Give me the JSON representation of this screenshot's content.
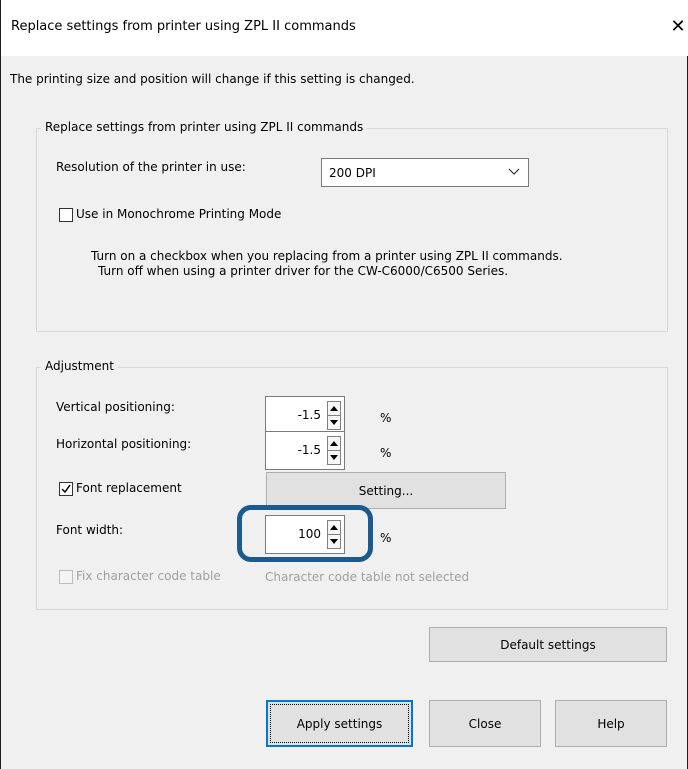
{
  "window": {
    "title": "Replace settings from printer using ZPL II commands",
    "close_glyph": "✕"
  },
  "intro_text": "The printing size and position will change if this setting is changed.",
  "replace_group": {
    "label": "Replace settings from printer using ZPL II commands",
    "resolution_label": "Resolution of the printer in use:",
    "resolution_value": "200 DPI",
    "monochrome_label": "Use in Monochrome Printing Mode",
    "monochrome_checked": false,
    "note_line1": "Turn on a checkbox when you replacing from a printer using ZPL II commands.",
    "note_line2": "Turn off when using a printer driver for the CW-C6000/C6500 Series."
  },
  "adjustment_group": {
    "label": "Adjustment",
    "vertical_label": "Vertical positioning:",
    "vertical_value": "-1.5",
    "vertical_unit": "%",
    "horizontal_label": "Horizontal positioning:",
    "horizontal_value": "-1.5",
    "horizontal_unit": "%",
    "font_replacement_label": "Font replacement",
    "font_replacement_checked": true,
    "setting_button": "Setting...",
    "font_width_label": "Font width:",
    "font_width_value": "100",
    "font_width_unit": "%",
    "fix_code_table_label": "Fix character code table",
    "code_table_status": "Character code table not selected"
  },
  "buttons": {
    "default_settings": "Default settings",
    "apply": "Apply settings",
    "close": "Close",
    "help": "Help"
  },
  "colors": {
    "highlight": "#1b5a8e",
    "default_button_border": "#0078d7"
  }
}
